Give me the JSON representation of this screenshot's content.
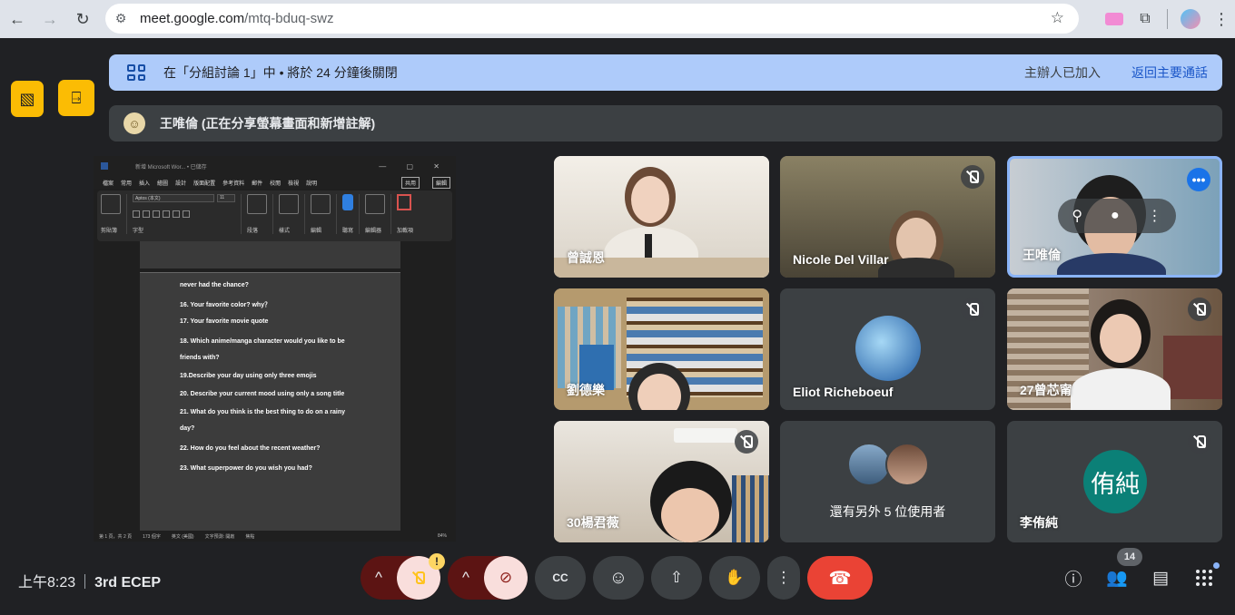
{
  "browser": {
    "url_host": "meet.google.com",
    "url_path": "/mtq-bduq-swz",
    "back_icon": "←",
    "forward_icon": "→",
    "reload_icon": "↻",
    "star_icon": "☆",
    "extensions_icon": "⧉",
    "menu_icon": "⋮",
    "site_info_icon": "⚙"
  },
  "side_buttons": {
    "left_icon": "▧",
    "right_icon": "⍈"
  },
  "banner": {
    "message": "在「分組討論 1」中 • 將於 24 分鐘後關閉",
    "host_joined": "主辦人已加入",
    "return_main": "返回主要通話"
  },
  "presenter": {
    "text": "王唯倫 (正在分享螢幕畫面和新增註解)",
    "avatar_icon": "☺"
  },
  "shared_doc": {
    "title": "新增 Microsoft Wor... • 已儲存",
    "window_controls": "— ▢ ✕",
    "tabs": [
      "檔案",
      "常用",
      "插入",
      "繪圖",
      "設計",
      "版面配置",
      "參考資料",
      "郵件",
      "校閱",
      "檢視",
      "說明"
    ],
    "share_label": "共用",
    "edit_label": "編輯",
    "font_name": "Aptos (本文)",
    "font_size": "11",
    "ribbon_labels": [
      "剪貼簿",
      "字型",
      "段落",
      "樣式",
      "編輯",
      "聽寫",
      "編輯器",
      "加載項"
    ],
    "lines": [
      "never had the chance?",
      "16. Your favorite color? why？",
      "17.   Your favorite movie quote",
      "18. Which anime/manga character would you like to be",
      "friends with?",
      "19.Describe your day using only three emojis",
      "20.   Describe your current mood using only a song title",
      "21. What do you think is the best thing to do on a rainy",
      "day?",
      "22. How do you feel about the recent weather?",
      "23. What superpower do you wish you had?"
    ],
    "status_items": [
      "第 1 頁，共 2 頁",
      "173 個字",
      "英文 (美國)",
      "文字預測: 開啟",
      "焦點"
    ],
    "zoom": "84%"
  },
  "tiles": [
    {
      "name": "曾誠恩",
      "muted": false
    },
    {
      "name": "Nicole Del Villar",
      "muted": true
    },
    {
      "name": "王唯倫",
      "muted": false,
      "active": true
    },
    {
      "name": "劉德樂",
      "muted": false
    },
    {
      "name": "Eliot Richeboeuf",
      "muted": true
    },
    {
      "name": "27曾芯甯",
      "muted": true
    },
    {
      "name": "30楊君薇",
      "muted": true
    },
    {
      "name": "還有另外 5 位使用者",
      "muted": false
    },
    {
      "name": "李侑純",
      "muted": true,
      "avatar_text": "侑純",
      "avatar_color": "#0b8077"
    }
  ],
  "bottom_bar": {
    "time": "上午8:23",
    "meeting_name": "3rd ECEP",
    "warning_mark": "!",
    "participant_count": "14",
    "chevron_icon": "^",
    "camera_off_icon": "⊘",
    "captions_icon": "CC",
    "emoji_icon": "☺",
    "present_icon": "⇧",
    "hand_icon": "✋",
    "more_icon": "⋮",
    "end_call_icon": "☎",
    "info_icon": "ⓘ",
    "people_icon": "👥",
    "chat_icon": "▤"
  },
  "colors": {
    "background": "#202124",
    "banner": "#aecbfa",
    "accent_blue": "#1a73e8",
    "end_call": "#ea4335",
    "side_button": "#fbbc04"
  }
}
